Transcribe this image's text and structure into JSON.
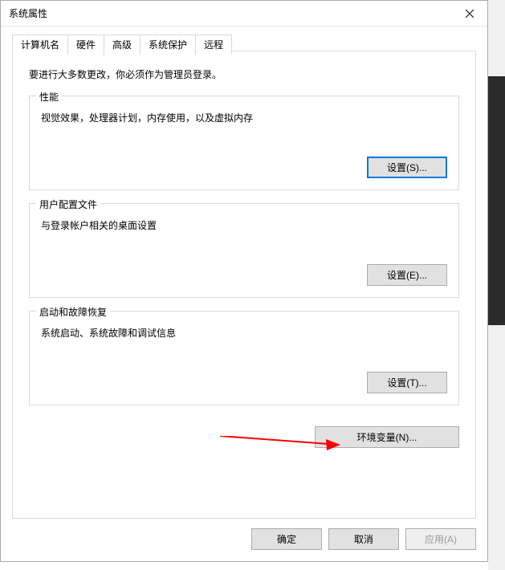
{
  "window": {
    "title": "系统属性"
  },
  "tabs": [
    {
      "label": "计算机名"
    },
    {
      "label": "硬件"
    },
    {
      "label": "高级"
    },
    {
      "label": "系统保护"
    },
    {
      "label": "远程"
    }
  ],
  "intro": "要进行大多数更改，你必须作为管理员登录。",
  "groups": {
    "performance": {
      "title": "性能",
      "desc": "视觉效果，处理器计划，内存使用，以及虚拟内存",
      "button": "设置(S)..."
    },
    "userProfiles": {
      "title": "用户配置文件",
      "desc": "与登录帐户相关的桌面设置",
      "button": "设置(E)..."
    },
    "startup": {
      "title": "启动和故障恢复",
      "desc": "系统启动、系统故障和调试信息",
      "button": "设置(T)..."
    }
  },
  "envButton": "环境变量(N)...",
  "bottomButtons": {
    "ok": "确定",
    "cancel": "取消",
    "apply": "应用(A)"
  }
}
